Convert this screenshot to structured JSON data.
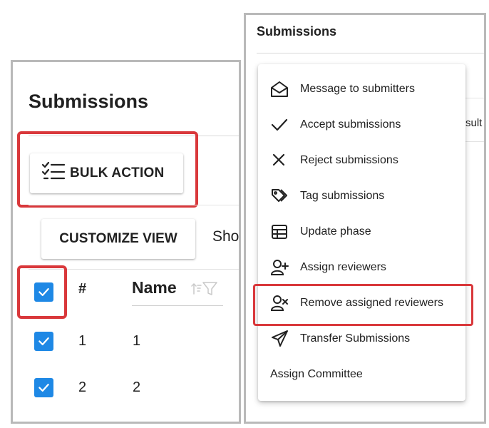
{
  "left": {
    "title": "Submissions",
    "bulk_action_label": "BULK ACTION",
    "customize_view_label": "CUSTOMIZE VIEW",
    "show_fragment": "Sho",
    "table": {
      "headers": {
        "number": "#",
        "name": "Name"
      },
      "rows": [
        {
          "number": "1",
          "name": "1"
        },
        {
          "number": "2",
          "name": "2"
        }
      ]
    }
  },
  "right": {
    "title": "Submissions",
    "result_fragment": "sult",
    "menu": {
      "items": [
        {
          "label": "Message to submitters",
          "icon": "envelope-open-icon"
        },
        {
          "label": "Accept submissions",
          "icon": "checkmark-icon"
        },
        {
          "label": "Reject submissions",
          "icon": "close-icon"
        },
        {
          "label": "Tag submissions",
          "icon": "tag-icon"
        },
        {
          "label": "Update phase",
          "icon": "table-icon"
        },
        {
          "label": "Assign reviewers",
          "icon": "person-add-icon"
        },
        {
          "label": "Remove assigned reviewers",
          "icon": "person-remove-icon"
        },
        {
          "label": "Transfer Submissions",
          "icon": "paper-plane-icon"
        },
        {
          "label": "Assign Committee",
          "icon": ""
        }
      ]
    }
  },
  "colors": {
    "highlight": "#d9383b",
    "checkbox": "#1e88e5",
    "panel_border": "#b9b9b9"
  }
}
